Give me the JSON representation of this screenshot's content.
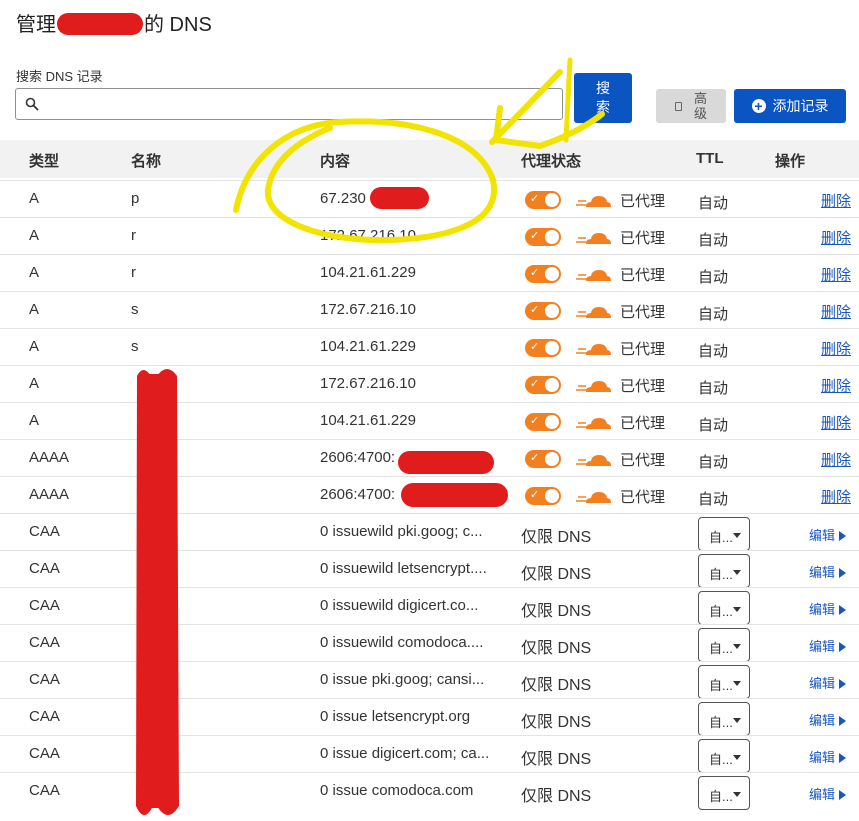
{
  "header": {
    "title_prefix": "管理",
    "title_suffix": "的 DNS"
  },
  "search": {
    "label": "搜索 DNS 记录",
    "value": "",
    "placeholder": "",
    "button_label": "搜索"
  },
  "toolbar": {
    "advanced_label": "高级",
    "add_record_label": "添加记录"
  },
  "table": {
    "headers": {
      "type": "类型",
      "name": "名称",
      "content": "内容",
      "proxy_status": "代理状态",
      "ttl": "TTL",
      "actions": "操作"
    },
    "proxied_label": "已代理",
    "dns_only_label": "仅限 DNS",
    "delete_label": "删除",
    "edit_label": "编辑",
    "ttl_auto": "自动",
    "ttl_select_value": "自...",
    "rows": [
      {
        "type": "A",
        "name": "p",
        "content": "67.230",
        "proxied": true
      },
      {
        "type": "A",
        "name": "r",
        "content": "172.67.216.10",
        "proxied": true
      },
      {
        "type": "A",
        "name": "r",
        "content": "104.21.61.229",
        "proxied": true
      },
      {
        "type": "A",
        "name": "s",
        "content": "172.67.216.10",
        "proxied": true
      },
      {
        "type": "A",
        "name": "s",
        "content": "104.21.61.229",
        "proxied": true
      },
      {
        "type": "A",
        "name": "",
        "content": "172.67.216.10",
        "proxied": true
      },
      {
        "type": "A",
        "name": "",
        "content": "104.21.61.229",
        "proxied": true
      },
      {
        "type": "AAAA",
        "name": "",
        "content": "2606:4700:",
        "proxied": true
      },
      {
        "type": "AAAA",
        "name": "",
        "content": "2606:4700:",
        "proxied": true
      },
      {
        "type": "CAA",
        "name": "",
        "content": "0 issuewild pki.goog; c...",
        "proxied": false
      },
      {
        "type": "CAA",
        "name": "",
        "content": "0 issuewild letsencrypt....",
        "proxied": false
      },
      {
        "type": "CAA",
        "name": "",
        "content": "0 issuewild digicert.co...",
        "proxied": false
      },
      {
        "type": "CAA",
        "name": "",
        "content": "0 issuewild comodoca....",
        "proxied": false
      },
      {
        "type": "CAA",
        "name": "",
        "content": "0 issue pki.goog; cansi...",
        "proxied": false
      },
      {
        "type": "CAA",
        "name": "",
        "content": "0 issue letsencrypt.org",
        "proxied": false
      },
      {
        "type": "CAA",
        "name": "",
        "content": "0 issue digicert.com; ca...",
        "proxied": false
      },
      {
        "type": "CAA",
        "name": "",
        "content": "0 issue comodoca.com",
        "proxied": false
      }
    ]
  },
  "icons": {
    "search": "search-icon",
    "advanced": "document-icon",
    "add": "plus-circle-icon",
    "cloud": "cloud-icon",
    "edit_arrow": "caret-right-icon"
  },
  "colors": {
    "primary": "#0a55c1",
    "proxy_orange": "#f38020",
    "redaction": "#e11c1c",
    "annotation": "#f2e300"
  }
}
